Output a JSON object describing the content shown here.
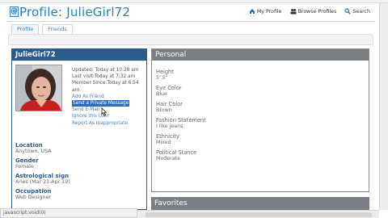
{
  "app": {
    "logo_glyph": "@",
    "title": "Profile: JulieGirl72"
  },
  "nav": [
    {
      "label": "My Profile",
      "icon": "home-icon"
    },
    {
      "label": "Browse Profiles",
      "icon": "people-icon"
    },
    {
      "label": "Search",
      "icon": "search-icon"
    }
  ],
  "tabs": [
    {
      "label": "Profile"
    },
    {
      "label": "Friends"
    }
  ],
  "profile": {
    "username": "JulieGirl72",
    "meta": {
      "updated": "Updated: Today at 10:28 am",
      "last_visit": "Last visit:Today at 7:32 am",
      "member_since": "Member Since:Today at 6:54",
      "member_since_cont": "am"
    },
    "actions": {
      "add_friend": "Add As Friend",
      "send_pm": "Send a Private Message",
      "send_email": "Send E-Mail",
      "ignore": "Ignore this User",
      "report": "Report As Inappropriate"
    },
    "facts": [
      {
        "label": "Location",
        "value": "Anytown, USA"
      },
      {
        "label": "Gender",
        "value": "Female"
      },
      {
        "label": "Astrological sign",
        "value": "Aries (Mar 21-Apr 19)"
      },
      {
        "label": "Occupation",
        "value": "Web Designer"
      }
    ]
  },
  "personal": {
    "heading": "Personal",
    "facts": [
      {
        "label": "Height",
        "value": "5' 5\""
      },
      {
        "label": "Eye Color",
        "value": "Blue"
      },
      {
        "label": "Hair Color",
        "value": "Brown"
      },
      {
        "label": "Fashion Statement",
        "value": "I like jeans"
      },
      {
        "label": "Ethnicity",
        "value": "Mixed"
      },
      {
        "label": "Political Stance",
        "value": "Moderate"
      }
    ]
  },
  "favorites": {
    "heading": "Favorites"
  },
  "status_bar": {
    "text": "javascript:void(0)"
  },
  "colors": {
    "title_blue": "#2a7fc0",
    "panel_header_navy": "#2b5a8b",
    "panel_header_gray": "#7a7f85",
    "selection_blue": "#2c6bc5",
    "link_blue": "#4a7fb1"
  }
}
